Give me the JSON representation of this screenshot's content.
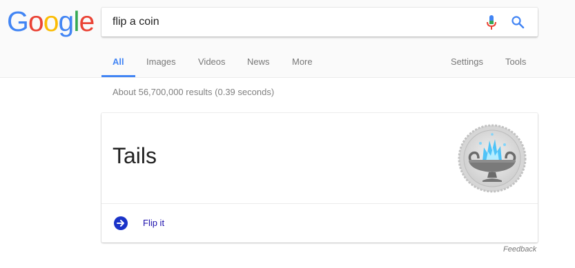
{
  "brand": {
    "letters": [
      "G",
      "o",
      "o",
      "g",
      "l",
      "e"
    ],
    "letter_colors": [
      "#4285f4",
      "#ea4335",
      "#fbbc05",
      "#4285f4",
      "#34a853",
      "#ea4335"
    ]
  },
  "search": {
    "value": "flip a coin",
    "icons": [
      "mic-icon",
      "search-icon"
    ]
  },
  "tabs": {
    "all": "All",
    "images": "Images",
    "videos": "Videos",
    "news": "News",
    "more": "More",
    "settings": "Settings",
    "tools": "Tools",
    "active": "All"
  },
  "stats": "About 56,700,000 results (0.39 seconds)",
  "coin_card": {
    "result": "Tails",
    "flip_label": "Flip it",
    "coin_icon": "coin-tails-fountain-icon",
    "flip_icon": "arrow-right-circle-icon"
  },
  "feedback": "Feedback",
  "colors": {
    "accent": "#4285f4",
    "link": "#1a0dab",
    "flip_button": "#1a33c8"
  }
}
